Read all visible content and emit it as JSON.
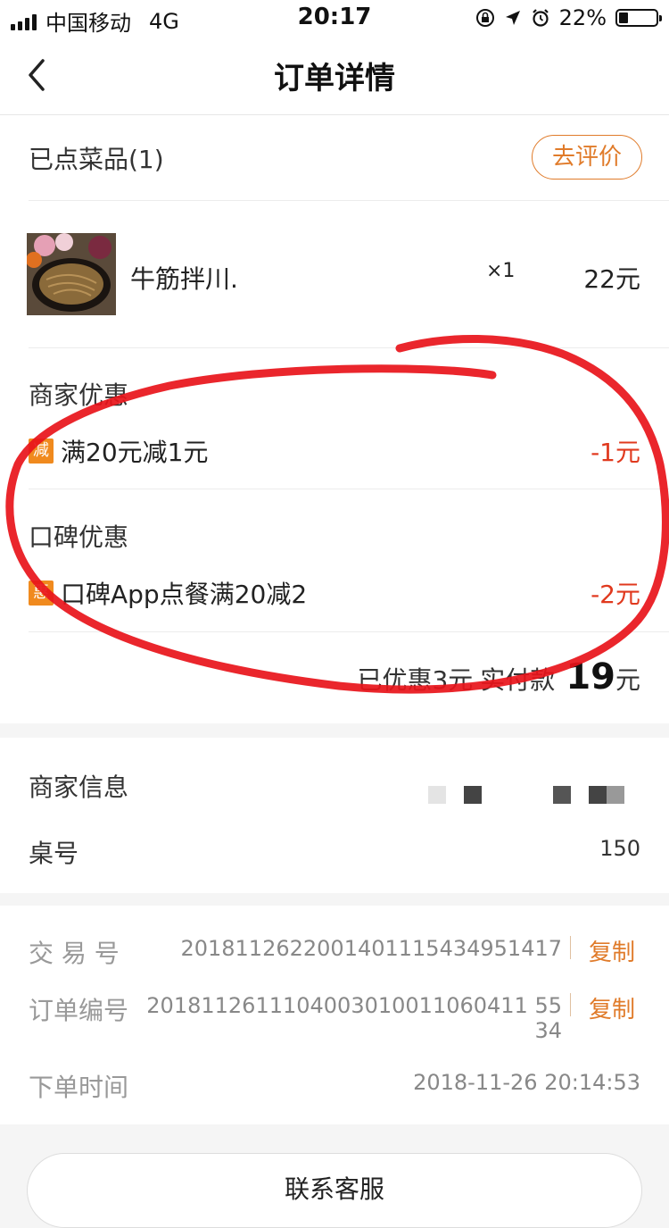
{
  "status_bar": {
    "carrier": "中国移动",
    "network": "4G",
    "time": "20:17",
    "battery": "22%"
  },
  "nav": {
    "title": "订单详情"
  },
  "order_items": {
    "header": "已点菜品(1)",
    "review_button": "去评价",
    "items": [
      {
        "name": "牛筋拌川.",
        "qty": "×1",
        "price": "22元"
      }
    ]
  },
  "merchant_discount": {
    "title": "商家优惠",
    "tag": "减",
    "desc": "满20元减1元",
    "value": "-1元"
  },
  "koubei_discount": {
    "title": "口碑优惠",
    "tag": "惠",
    "desc": "口碑App点餐满20减2",
    "value": "-2元"
  },
  "summary": {
    "saved": "已优惠3元",
    "paid_label": "实付款",
    "paid_amount": "19",
    "paid_unit": "元"
  },
  "merchant_info": {
    "title": "商家信息",
    "table_label": "桌号",
    "table_value": "150"
  },
  "transaction": {
    "trade_no_label": "交 易 号",
    "trade_no": "2018112622001401115434951417",
    "order_no_label": "订单编号",
    "order_no_line1": "2018112611104003010011060411 55",
    "order_no_line2": "34",
    "time_label": "下单时间",
    "time_value": "2018-11-26 20:14:53",
    "copy_label": "复制"
  },
  "contact": {
    "button": "联系客服"
  },
  "colors": {
    "accent": "#e07b2a",
    "discount": "#e0391e",
    "tag": "#f08a1e",
    "annotation": "#e8141a"
  }
}
